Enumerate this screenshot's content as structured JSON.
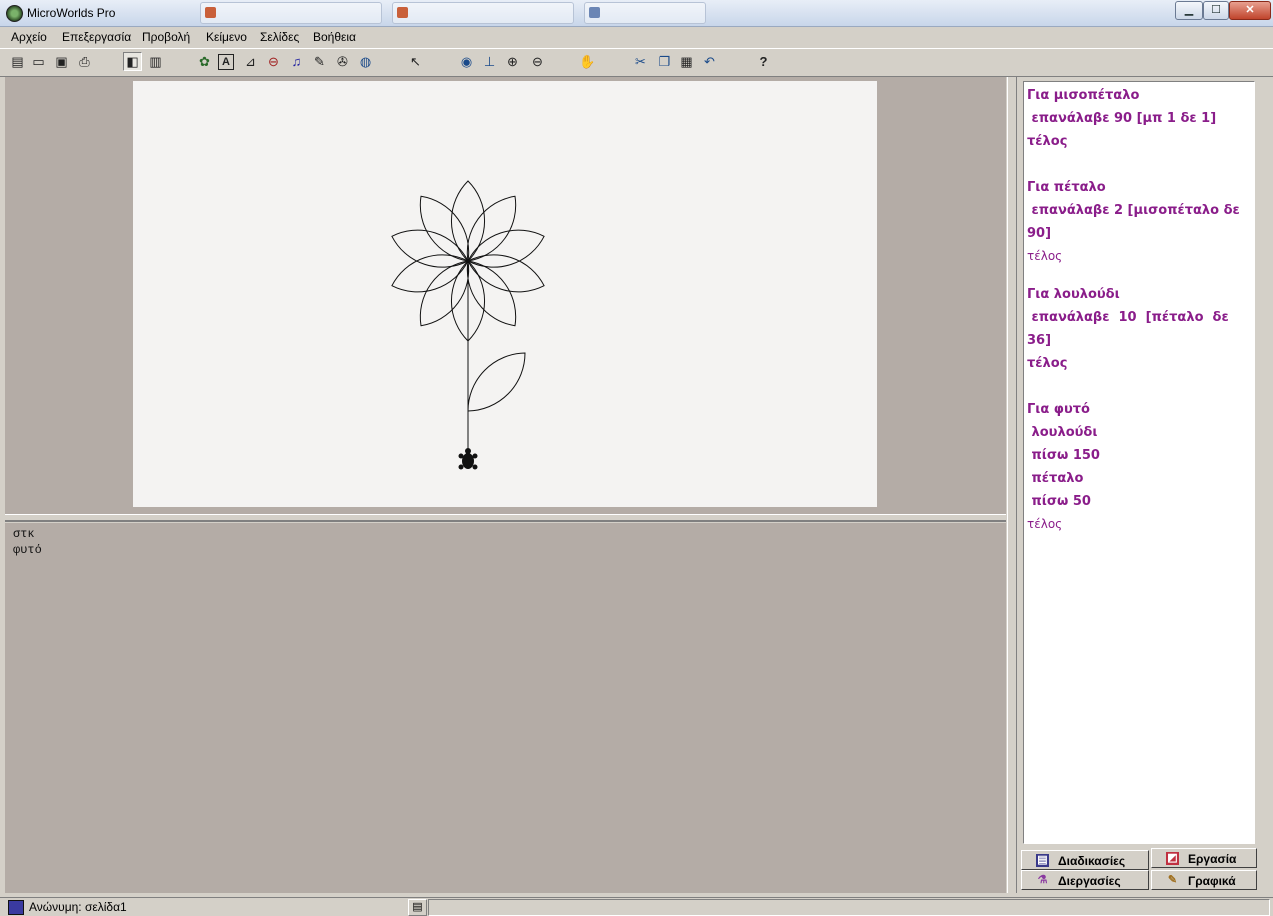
{
  "window": {
    "title": "MicroWorlds Pro",
    "controls": {
      "minimize": "▁",
      "maximize": "☐",
      "close": "✕"
    }
  },
  "menu": [
    "Αρχείο",
    "Επεξεργασία",
    "Προβολή",
    "Κείμενο",
    "Σελίδες",
    "Βοήθεια"
  ],
  "toolbar": [
    {
      "name": "new-page-icon",
      "glyph": "▤"
    },
    {
      "name": "open-icon",
      "glyph": "▭"
    },
    {
      "name": "save-icon",
      "glyph": "▣"
    },
    {
      "name": "print-icon",
      "glyph": "⎙"
    },
    {
      "name": "page-view-icon",
      "glyph": "◧",
      "pressed": true
    },
    {
      "name": "procedures-view-icon",
      "glyph": "▥"
    },
    {
      "name": "new-turtle-icon",
      "glyph": "✿"
    },
    {
      "name": "text-box-icon",
      "glyph": "A"
    },
    {
      "name": "slider-icon",
      "glyph": "⊿"
    },
    {
      "name": "button-tool-icon",
      "glyph": "⊖"
    },
    {
      "name": "music-icon",
      "glyph": "♫"
    },
    {
      "name": "paint-icon",
      "glyph": "✎"
    },
    {
      "name": "video-icon",
      "glyph": "✇"
    },
    {
      "name": "globe-icon",
      "glyph": "◍"
    },
    {
      "name": "pointer-icon",
      "glyph": "↖"
    },
    {
      "name": "eye-icon",
      "glyph": "◉"
    },
    {
      "name": "stamp-icon",
      "glyph": "⊥"
    },
    {
      "name": "zoom-in-icon",
      "glyph": "⊕"
    },
    {
      "name": "zoom-out-icon",
      "glyph": "⊖"
    },
    {
      "name": "stop-icon",
      "glyph": "✋"
    },
    {
      "name": "cut-icon",
      "glyph": "✂"
    },
    {
      "name": "copy-icon",
      "glyph": "❐"
    },
    {
      "name": "paste-icon",
      "glyph": "▦"
    },
    {
      "name": "undo-icon",
      "glyph": "↶"
    },
    {
      "name": "help-icon",
      "glyph": "?"
    }
  ],
  "command_center": {
    "lines": [
      "στκ",
      "φυτό"
    ]
  },
  "procedures": [
    {
      "text": "Για μισοπέταλο",
      "style": "b"
    },
    {
      "text": " επανάλαβε 90 [μπ 1 δε 1]",
      "style": "b"
    },
    {
      "text": "τέλος",
      "style": "b"
    },
    {
      "text": "Για πέταλο",
      "style": "b"
    },
    {
      "text": " επανάλαβε 2 [μισοπέταλο δε",
      "style": "b"
    },
    {
      "text": "90]",
      "style": "b"
    },
    {
      "text": "τέλος",
      "style": "s"
    },
    {
      "text": "Για λουλούδι",
      "style": "b"
    },
    {
      "text": " επανάλαβε  10  [πέταλο  δε",
      "style": "b"
    },
    {
      "text": "36]",
      "style": "b"
    },
    {
      "text": "τέλος",
      "style": "b"
    },
    {
      "text": "Για φυτό",
      "style": "b"
    },
    {
      "text": " λουλούδι",
      "style": "b"
    },
    {
      "text": " πίσω 150",
      "style": "b"
    },
    {
      "text": " πέταλο",
      "style": "b"
    },
    {
      "text": " πίσω 50",
      "style": "b"
    },
    {
      "text": "τέλος",
      "style": "s"
    }
  ],
  "tabs": {
    "procedures": "Διαδικασίες",
    "project": "Εργασία",
    "processes": "Διεργασίες",
    "graphics": "Γραφικά"
  },
  "status": {
    "page": "Ανώνυμη:  σελίδα1"
  },
  "colors": {
    "procedure_text": "#8a1d8a",
    "workarea": "#b4aca6",
    "canvas": "#f4f3f2"
  }
}
